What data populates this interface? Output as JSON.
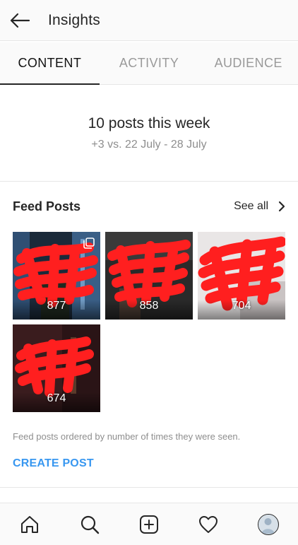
{
  "header": {
    "title": "Insights",
    "back_icon": "arrow-left-icon"
  },
  "tabs": [
    {
      "label": "CONTENT",
      "active": true
    },
    {
      "label": "ACTIVITY",
      "active": false
    },
    {
      "label": "AUDIENCE",
      "active": false
    }
  ],
  "summary": {
    "title": "10 posts this week",
    "comparison": "+3 vs. 22 July - 28 July"
  },
  "feed": {
    "title": "Feed Posts",
    "see_all_label": "See all",
    "posts": [
      {
        "count": "877",
        "multi": true
      },
      {
        "count": "858",
        "multi": false
      },
      {
        "count": "704",
        "multi": false
      },
      {
        "count": "674",
        "multi": false
      }
    ],
    "note": "Feed posts ordered by number of times they were seen.",
    "create_label": "CREATE POST"
  },
  "bottom_nav": [
    {
      "icon": "home-icon"
    },
    {
      "icon": "search-icon"
    },
    {
      "icon": "add-post-icon"
    },
    {
      "icon": "heart-icon"
    },
    {
      "icon": "profile-avatar"
    }
  ],
  "colors": {
    "accent": "#3897f0",
    "text": "#262626",
    "muted": "#8e8e8e",
    "redaction": "#ff1f1f"
  }
}
